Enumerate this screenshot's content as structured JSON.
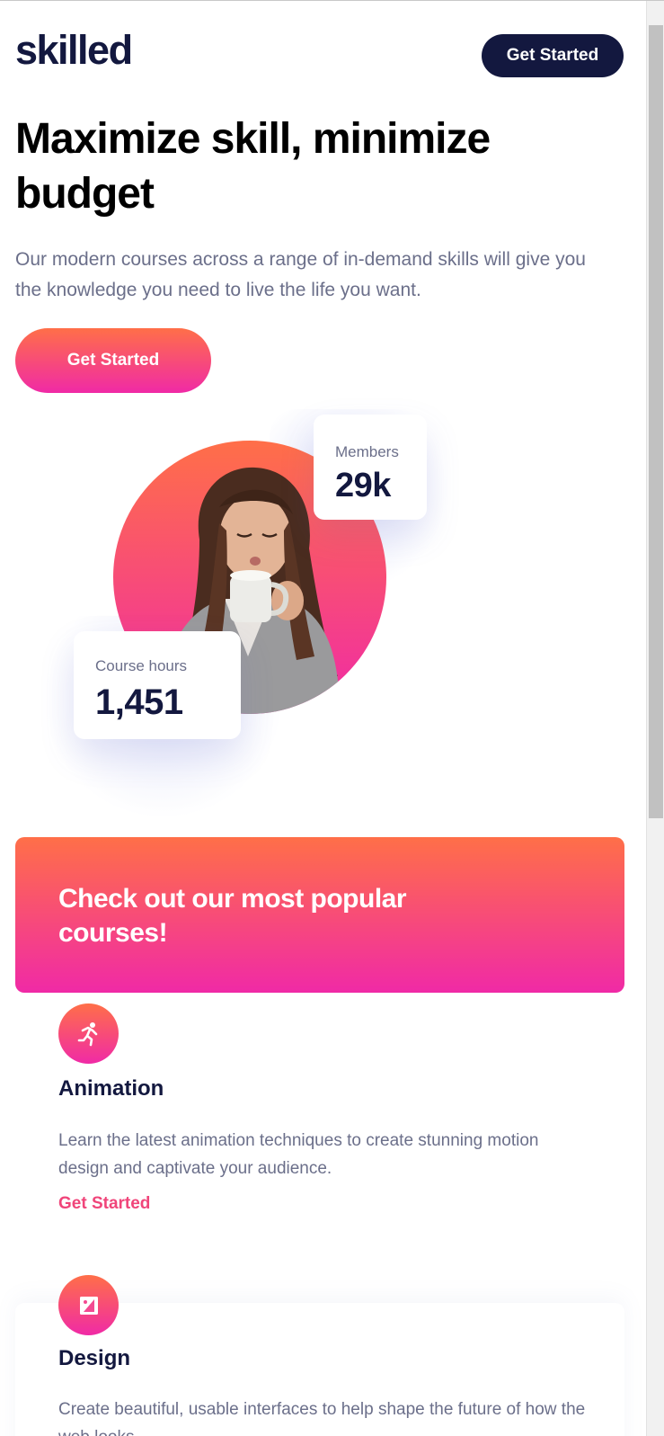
{
  "header": {
    "logo_text": "skilled",
    "cta_label": "Get Started"
  },
  "hero": {
    "title": "Maximize skill, minimize budget",
    "description": "Our modern courses across a range of in-demand skills will give you the knowledge you need to live the life you want.",
    "cta_label": "Get Started",
    "stats": {
      "members": {
        "label": "Members",
        "value": "29k"
      },
      "course_hours": {
        "label": "Course hours",
        "value": "1,451"
      }
    }
  },
  "promo": {
    "title": "Check out our most popular courses!"
  },
  "courses": [
    {
      "icon": "running-person-icon",
      "title": "Animation",
      "description": "Learn the latest animation techniques to create stunning motion design and captivate your audience.",
      "link_label": "Get Started"
    },
    {
      "icon": "image-frame-icon",
      "title": "Design",
      "description": "Create beautiful, usable interfaces to help shape the future of how the web looks."
    }
  ],
  "colors": {
    "navy": "#13183f",
    "gradient_top": "#ff6f48",
    "gradient_bottom": "#f02aa6",
    "body_text": "#6b6f8a",
    "link": "#f0457a"
  }
}
